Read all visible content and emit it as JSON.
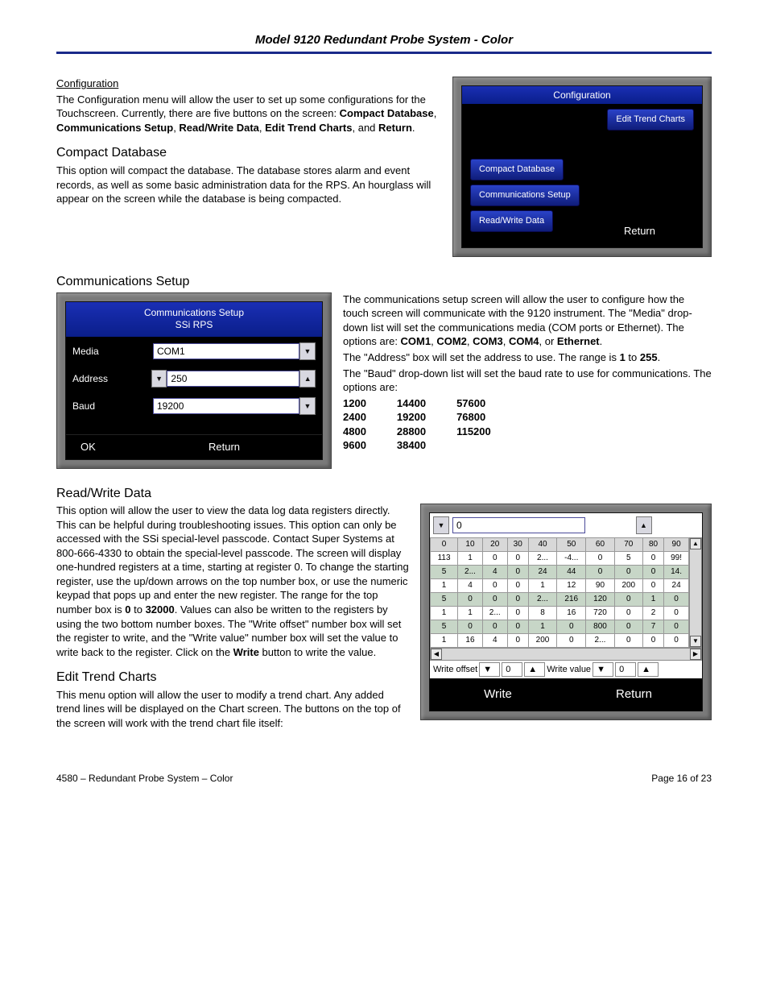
{
  "header": {
    "title": "Model 9120 Redundant Probe System - Color"
  },
  "config": {
    "heading": "Configuration",
    "intro": "The Configuration menu will allow the user to set up some configurations for the Touchscreen.  Currently, there are five buttons on the screen: ",
    "btn_list": [
      "Compact Database",
      "Communications Setup",
      "Read/Write Data",
      "Edit Trend Charts",
      "Return"
    ],
    "panel": {
      "title": "Configuration",
      "edit_trend": "Edit Trend Charts",
      "compact_db": "Compact Database",
      "comm_setup": "Communications Setup",
      "rw_data": "Read/Write Data",
      "return": "Return"
    }
  },
  "compact": {
    "heading": "Compact Database",
    "text": "This option will compact the database.  The database stores alarm and event records, as well as some basic administration data for the RPS.  An hourglass will appear on the screen while the database is being compacted."
  },
  "comm": {
    "heading": "Communications Setup",
    "panel": {
      "title1": "Communications Setup",
      "title2": "SSi RPS",
      "media_label": "Media",
      "media_value": "COM1",
      "addr_label": "Address",
      "addr_value": "250",
      "baud_label": "Baud",
      "baud_value": "19200",
      "ok": "OK",
      "return": "Return"
    },
    "para1a": "The communications setup screen will allow the user to configure how the touch screen will communicate with the 9120 instrument.  The \"Media\" drop-down list will set the communications media (COM ports or Ethernet).  The options are: ",
    "media_opts": [
      "COM1",
      "COM2",
      "COM3",
      "COM4",
      "Ethernet"
    ],
    "para2a": "The \"Address\" box will set the address to use.  The range is ",
    "addr_min": "1",
    "addr_max": "255",
    "para3": "The \"Baud\" drop-down list will set the baud rate to use for communications.  The options are:",
    "baud_cols": [
      [
        "1200",
        "2400",
        "4800",
        "9600"
      ],
      [
        "14400",
        "19200",
        "28800",
        "38400"
      ],
      [
        "57600",
        "76800",
        "115200"
      ]
    ]
  },
  "rw": {
    "heading": "Read/Write Data",
    "text_a": "This option will allow the user to view the data log data registers directly.  This can be helpful during troubleshooting issues.  This option can only be accessed with the SSi special-level passcode.  Contact Super Systems at 800-666-4330 to obtain the special-level passcode.  The screen will display one-hundred registers at a time, starting at register 0.  To change the starting register, use the up/down arrows on the top number box, or use the numeric keypad that pops up and enter the new register.  The range for the top number box is ",
    "range_min": "0",
    "range_max": "32000",
    "text_b": ".  Values can also be written to the registers by using the two bottom number boxes.  The \"Write offset\" number box will set the register to write, and the \"Write value\" number box will set the value to write back to the register.  Click on the ",
    "write_word": "Write",
    "text_c": " button to write the value.",
    "panel": {
      "top_value": "0",
      "cols": [
        "0",
        "10",
        "20",
        "30",
        "40",
        "50",
        "60",
        "70",
        "80",
        "90"
      ],
      "rows": [
        [
          "113",
          "1",
          "0",
          "0",
          "2...",
          "-4...",
          "0",
          "5",
          "0",
          "99!"
        ],
        [
          "5",
          "2...",
          "4",
          "0",
          "24",
          "44",
          "0",
          "0",
          "0",
          "14."
        ],
        [
          "1",
          "4",
          "0",
          "0",
          "1",
          "12",
          "90",
          "200",
          "0",
          "24"
        ],
        [
          "5",
          "0",
          "0",
          "0",
          "2...",
          "216",
          "120",
          "0",
          "1",
          "0"
        ],
        [
          "1",
          "1",
          "2...",
          "0",
          "8",
          "16",
          "720",
          "0",
          "2",
          "0"
        ],
        [
          "5",
          "0",
          "0",
          "0",
          "1",
          "0",
          "800",
          "0",
          "7",
          "0"
        ],
        [
          "1",
          "16",
          "4",
          "0",
          "200",
          "0",
          "2...",
          "0",
          "0",
          "0"
        ]
      ],
      "write_offset_label": "Write offset",
      "write_offset_value": "0",
      "write_value_label": "Write value",
      "write_value_value": "0",
      "write": "Write",
      "return": "Return"
    }
  },
  "etc": {
    "heading": "Edit Trend Charts",
    "text": "This menu option will allow the user to modify a trend chart.  Any added trend lines will be displayed on the Chart screen.  The buttons on the top of the screen will work with the trend chart file itself:"
  },
  "footer": {
    "left": "4580 – Redundant Probe System – Color",
    "right": "Page 16 of 23"
  }
}
